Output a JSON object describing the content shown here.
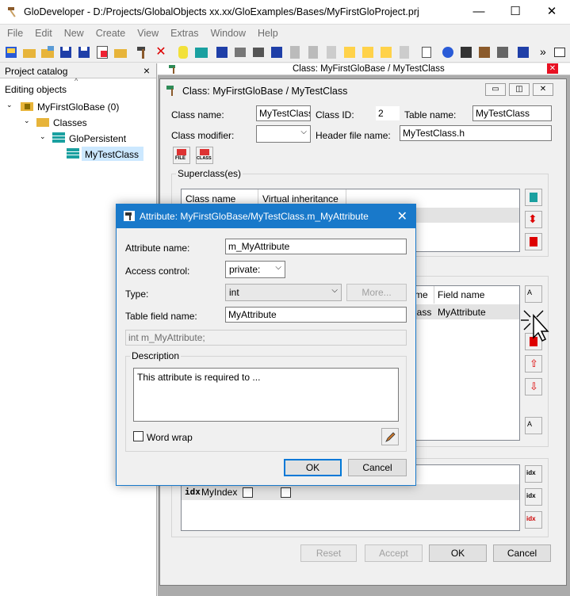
{
  "window": {
    "title": "GloDeveloper - D:/Projects/GlobalObjects xx.xx/GloExamples/Bases/MyFirstGloProject.prj",
    "controls": [
      "—",
      "☐",
      "✕"
    ]
  },
  "menu": [
    {
      "label": "File",
      "mnemonic": "F"
    },
    {
      "label": "Edit",
      "mnemonic": "E"
    },
    {
      "label": "New",
      "mnemonic": "N"
    },
    {
      "label": "Create",
      "mnemonic": "C"
    },
    {
      "label": "View",
      "mnemonic": "V"
    },
    {
      "label": "Extras",
      "mnemonic": "x"
    },
    {
      "label": "Window",
      "mnemonic": "W"
    },
    {
      "label": "Help",
      "mnemonic": "H"
    }
  ],
  "toolbar": {
    "overflow_label": "»"
  },
  "catalog": {
    "title": "Project catalog",
    "close_label": "×",
    "section_label": "Editing objects",
    "tree": [
      {
        "label": "MyFirstGloBase (0)"
      },
      {
        "label": "Classes"
      },
      {
        "label": "GloPersistent"
      },
      {
        "label": "MyTestClass"
      }
    ]
  },
  "mdi": {
    "tab_title": "Class: MyFirstGloBase / MyTestClass",
    "close_label": "✕"
  },
  "class_window": {
    "title": "Class: MyFirstGloBase / MyTestClass",
    "class_name_label": "Class name:",
    "class_name": "MyTestClass",
    "class_id_label": "Class ID:",
    "class_id": "2",
    "table_name_label": "Table name:",
    "table_name": "MyTestClass",
    "class_modifier_label": "Class modifier:",
    "class_modifier": "",
    "header_file_label": "Header file name:",
    "header_file": "MyTestClass.h",
    "file_icon_text": "FILE",
    "class_icon_text": "CLASS",
    "superclass_group": "Superclass(es)",
    "superclass_columns": [
      "Class name",
      "Virtual inheritance"
    ],
    "attr_columns_partial": [
      "me",
      "Field name"
    ],
    "attr_row": {
      "class_partial": "lass",
      "field": "MyAttribute"
    },
    "index_row": {
      "tag": "idx",
      "name": "MyIndex"
    },
    "buttons": {
      "reset": "Reset",
      "accept": "Accept",
      "ok": "OK",
      "cancel": "Cancel"
    }
  },
  "attribute_dialog": {
    "title": "Attribute: MyFirstGloBase/MyTestClass.m_MyAttribute",
    "close_label": "✕",
    "name_label": "Attribute name:",
    "name": "m_MyAttribute",
    "access_label": "Access control:",
    "access": "private:",
    "type_label": "Type:",
    "type": "int",
    "more_label": "More...",
    "table_field_label": "Table field name:",
    "table_field": "MyAttribute",
    "declaration": "int m_MyAttribute;",
    "description_label": "Description",
    "description": "This attribute is required to ...",
    "word_wrap_label": "Word wrap",
    "ok_label": "OK",
    "cancel_label": "Cancel"
  },
  "colors": {
    "accent": "#1979ca",
    "selection": "#cce8ff",
    "mdi_background": "#ababab"
  }
}
